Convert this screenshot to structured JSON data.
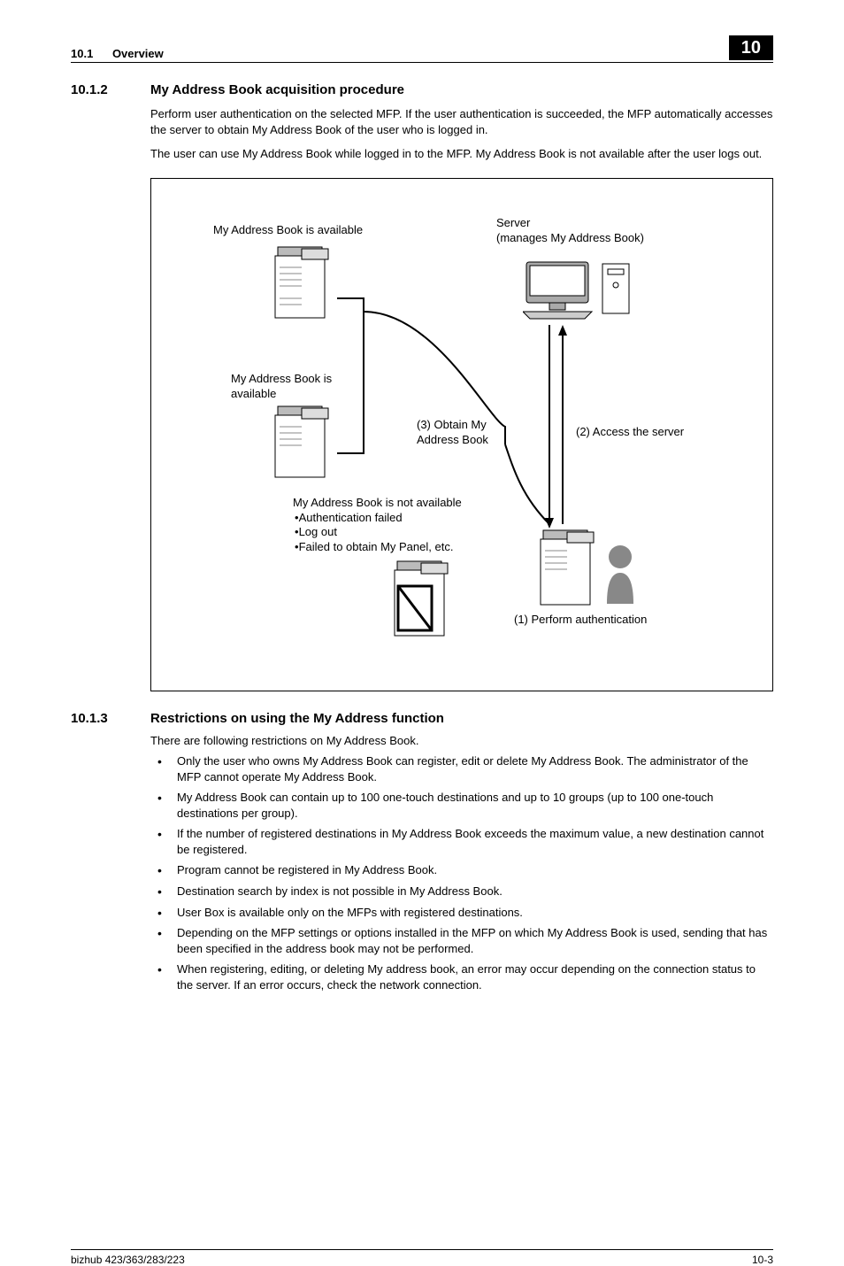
{
  "header": {
    "section_number": "10.1",
    "section_label": "Overview",
    "chapter": "10"
  },
  "s1": {
    "number": "10.1.2",
    "title": "My Address Book acquisition procedure",
    "p1": "Perform user authentication on the selected MFP. If the user authentication is succeeded, the MFP automatically accesses the server to obtain My Address Book of the user who is logged in.",
    "p2": "The user can use My Address Book while logged in to the MFP. My Address Book is not available after the user logs out."
  },
  "diagram": {
    "top_left": "My Address Book is available",
    "server_line1": "Server",
    "server_line2": "(manages My Address Book)",
    "left_avail_line1": "My Address Book is",
    "left_avail_line2": "available",
    "obtain_line1": "(3) Obtain My",
    "obtain_line2": "Address Book",
    "access": "(2) Access the server",
    "not_avail_title": "My Address Book is not available",
    "not_avail_b1": "Authentication failed",
    "not_avail_b2": "Log out",
    "not_avail_b3": "Failed to obtain My Panel, etc.",
    "perform_auth": "(1) Perform authentication"
  },
  "s2": {
    "number": "10.1.3",
    "title": "Restrictions on using the My Address function",
    "intro": "There are following restrictions on My Address Book.",
    "b1": "Only the user who owns My Address Book can register, edit or delete My Address Book. The administrator of the MFP cannot operate My Address Book.",
    "b2": "My Address Book can contain up to 100 one-touch destinations and up to 10 groups (up to 100 one-touch destinations per group).",
    "b3": "If the number of registered destinations in My Address Book exceeds the maximum value, a new destination cannot be registered.",
    "b4": "Program cannot be registered in My Address Book.",
    "b5": "Destination search by index is not possible in My Address Book.",
    "b6": "User Box is available only on the MFPs with registered destinations.",
    "b7": "Depending on the MFP settings or options installed in the MFP on which My Address Book is used, sending that has been specified in the address book may not be performed.",
    "b8": "When registering, editing, or deleting My address book, an error may occur depending on the connection status to the server. If an error occurs, check the network connection."
  },
  "footer": {
    "left": "bizhub 423/363/283/223",
    "right": "10-3"
  }
}
